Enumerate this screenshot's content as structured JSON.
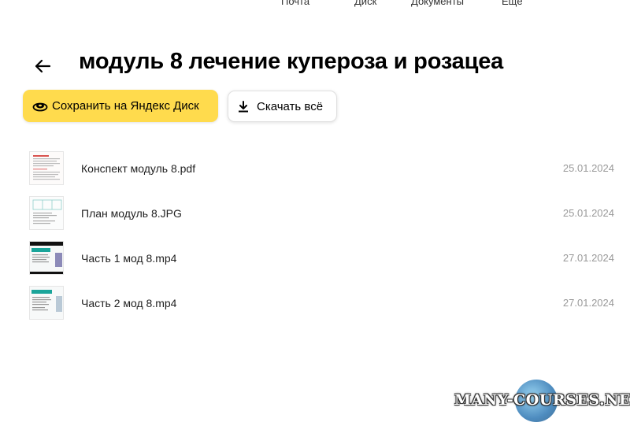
{
  "nav": {
    "mail": "Почта",
    "disk": "Диск",
    "docs": "Документы",
    "more": "Ещё"
  },
  "header": {
    "title": "модуль 8 лечение купероза и розацеа"
  },
  "actions": {
    "save_label": "Сохранить на Яндекс Диск",
    "download_label": "Скачать всё"
  },
  "files": [
    {
      "name": "Конспект модуль 8.pdf",
      "date": "25.01.2024",
      "kind": "pdf"
    },
    {
      "name": "План модуль 8.JPG",
      "date": "25.01.2024",
      "kind": "image"
    },
    {
      "name": "Часть 1 мод 8.mp4",
      "date": "27.01.2024",
      "kind": "video"
    },
    {
      "name": "Часть 2 мод 8.mp4",
      "date": "27.01.2024",
      "kind": "video"
    }
  ],
  "watermark": "MANY-COURSES.NET",
  "colors": {
    "accent": "#ffdb4d",
    "date": "#999999",
    "thumb_teal": "#1aa59a"
  }
}
